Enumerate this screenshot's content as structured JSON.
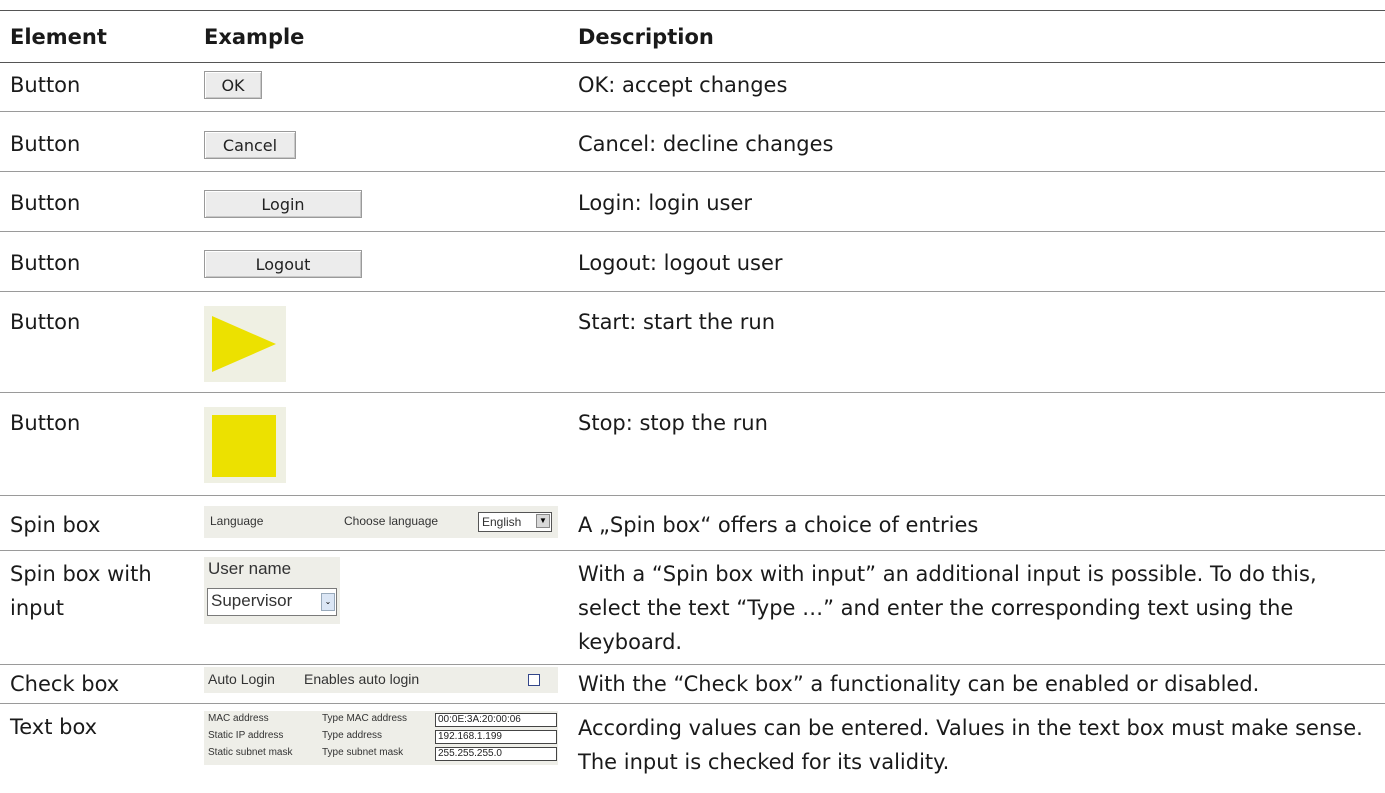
{
  "headers": {
    "element": "Element",
    "example": "Example",
    "description": "Description"
  },
  "rows": [
    {
      "element": "Button",
      "description": "OK: accept changes",
      "example": {
        "label": "OK"
      }
    },
    {
      "element": "Button",
      "description": "Cancel: decline changes",
      "example": {
        "label": "Cancel"
      }
    },
    {
      "element": "Button",
      "description": "Login: login user",
      "example": {
        "label": "Login"
      }
    },
    {
      "element": "Button",
      "description": "Logout: logout user",
      "example": {
        "label": "Logout"
      }
    },
    {
      "element": "Button",
      "description": "Start: start the run",
      "example": {
        "icon": "play-icon"
      }
    },
    {
      "element": "Button",
      "description": "Stop: stop the run",
      "example": {
        "icon": "stop-icon"
      }
    },
    {
      "element": "Spin box",
      "description": "A „Spin box“ offers a choice of entries",
      "example": {
        "label": "Language",
        "hint": "Choose language",
        "value": "English"
      }
    },
    {
      "element": "Spin box with input",
      "description": "With a “Spin box with input” an additional input is possible. To do this, select the text “Type …” and enter the corresponding text using the keyboard.",
      "example": {
        "label": "User name",
        "value": "Supervisor"
      }
    },
    {
      "element": "Check box",
      "description": "With the “Check box” a functionality can be enabled or disabled.",
      "example": {
        "label": "Auto Login",
        "hint": "Enables auto login",
        "checked": false
      }
    },
    {
      "element": "Text box",
      "description": "According values can be entered. Values in the text box must make sense. The input is checked for its validity.",
      "example": {
        "fields": [
          {
            "label": "MAC address",
            "hint": "Type MAC address",
            "value": "00:0E:3A:20:00:06"
          },
          {
            "label": "Static IP address",
            "hint": "Type address",
            "value": "192.168.1.199"
          },
          {
            "label": "Static subnet mask",
            "hint": "Type subnet mask",
            "value": "255.255.255.0"
          }
        ]
      }
    }
  ],
  "colors": {
    "accent_yellow": "#ece100",
    "icon_bg": "#eff0e3",
    "rule": "#9a9a9a"
  }
}
